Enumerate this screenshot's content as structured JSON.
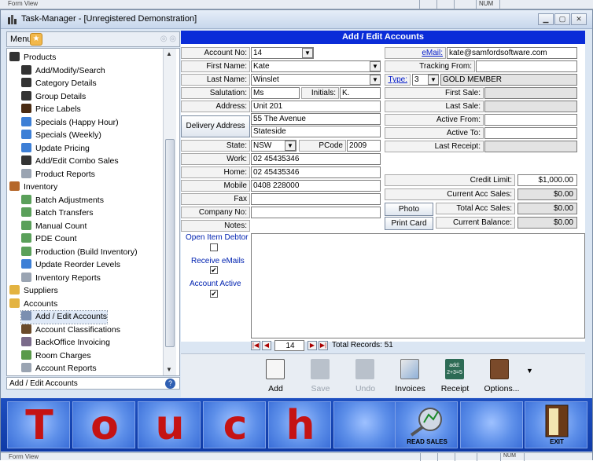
{
  "top_strip": {
    "label": "Form View",
    "indicator": "NUM"
  },
  "window": {
    "title": "Task-Manager - [Unregistered Demonstration]"
  },
  "menu": {
    "label": "Menu",
    "items": [
      {
        "label": "Products",
        "level": 0,
        "icon": "products-icon",
        "color": "#333333"
      },
      {
        "label": "Add/Modify/Search",
        "level": 1,
        "icon": "chart-icon",
        "color": "#333333"
      },
      {
        "label": "Category Details",
        "level": 1,
        "icon": "chart-icon",
        "color": "#333333"
      },
      {
        "label": "Group Details",
        "level": 1,
        "icon": "chart-icon",
        "color": "#333333"
      },
      {
        "label": "Price Labels",
        "level": 1,
        "icon": "label-icon",
        "color": "#4a2b12"
      },
      {
        "label": "Specials (Happy Hour)",
        "level": 1,
        "icon": "calendar-icon",
        "color": "#3d7fd6"
      },
      {
        "label": "Specials (Weekly)",
        "level": 1,
        "icon": "calendar-icon",
        "color": "#3d7fd6"
      },
      {
        "label": "Update Pricing",
        "level": 1,
        "icon": "calendar-icon",
        "color": "#3d7fd6"
      },
      {
        "label": "Add/Edit Combo Sales",
        "level": 1,
        "icon": "chart-icon",
        "color": "#333333"
      },
      {
        "label": "Product Reports",
        "level": 1,
        "icon": "report-icon",
        "color": "#9aa4b2"
      },
      {
        "label": "Inventory",
        "level": 0,
        "icon": "inventory-icon",
        "color": "#b5672a"
      },
      {
        "label": "Batch Adjustments",
        "level": 1,
        "icon": "checklist-icon",
        "color": "#5aa05a"
      },
      {
        "label": "Batch Transfers",
        "level": 1,
        "icon": "checklist-icon",
        "color": "#5aa05a"
      },
      {
        "label": "Manual Count",
        "level": 1,
        "icon": "checklist-icon",
        "color": "#5aa05a"
      },
      {
        "label": "PDE Count",
        "level": 1,
        "icon": "checklist-icon",
        "color": "#5aa05a"
      },
      {
        "label": "Production (Build Inventory)",
        "level": 1,
        "icon": "checklist-icon",
        "color": "#5aa05a"
      },
      {
        "label": "Update Reorder Levels",
        "level": 1,
        "icon": "calendar-icon",
        "color": "#3d7fd6"
      },
      {
        "label": "Inventory Reports",
        "level": 1,
        "icon": "report-icon",
        "color": "#9aa4b2"
      },
      {
        "label": "Suppliers",
        "level": 0,
        "icon": "folder-icon",
        "color": "#e3b341"
      },
      {
        "label": "Accounts",
        "level": 0,
        "icon": "folder-icon",
        "color": "#e3b341"
      },
      {
        "label": "Add / Edit Accounts",
        "level": 1,
        "icon": "accounts-icon",
        "color": "#7b8fb0"
      },
      {
        "label": "Account Classifications",
        "level": 1,
        "icon": "classification-icon",
        "color": "#6a4a2a"
      },
      {
        "label": "BackOffice Invoicing",
        "level": 1,
        "icon": "invoice-icon",
        "color": "#7a6a8a"
      },
      {
        "label": "Room Charges",
        "level": 1,
        "icon": "room-icon",
        "color": "#5a9a4a"
      },
      {
        "label": "Account Reports",
        "level": 1,
        "icon": "report-icon",
        "color": "#9aa4b2"
      }
    ],
    "status": "Add / Edit Accounts"
  },
  "form": {
    "header": "Add / Edit Accounts",
    "labels": {
      "account_no": "Account No:",
      "first_name": "First Name:",
      "last_name": "Last Name:",
      "salutation": "Salutation:",
      "initials": "Initials:",
      "address": "Address:",
      "delivery": "Delivery Address",
      "state": "State:",
      "pcode": "PCode",
      "work": "Work:",
      "home": "Home:",
      "mobile": "Mobile",
      "fax": "Fax",
      "company_no": "Company No:",
      "notes": "Notes:",
      "email": "eMail:",
      "tracking": "Tracking From:",
      "type": "Type:",
      "first_sale": "First Sale:",
      "last_sale": "Last Sale:",
      "active_from": "Active From:",
      "active_to": "Active To:",
      "last_receipt": "Last Receipt:",
      "credit_limit": "Credit Limit:",
      "current_acc_sales": "Current Acc Sales:",
      "total_acc_sales": "Total Acc Sales:",
      "current_balance": "Current Balance:",
      "open_item_debtor": "Open Item Debtor",
      "receive_emails": "Receive eMails",
      "account_active": "Account Active"
    },
    "values": {
      "account_no": "14",
      "first_name": "Kate",
      "last_name": "Winslet",
      "salutation": "Ms",
      "initials": "K.",
      "address": "Unit 201",
      "address2": "55 The Avenue",
      "address3": "Stateside",
      "state": "NSW",
      "pcode": "2009",
      "work": "02 45435346",
      "home": "02 45435346",
      "mobile": "0408 228000",
      "fax": "",
      "company_no": "",
      "notes": "",
      "email": "kate@samfordsoftware.com",
      "tracking": "",
      "type_no": "3",
      "type_name": "GOLD MEMBER",
      "credit_limit": "$1,000.00",
      "current_acc_sales": "$0.00",
      "total_acc_sales": "$0.00",
      "current_balance": "$0.00",
      "open_item_debtor": "",
      "receive_emails": "✔",
      "account_active": "✔"
    },
    "buttons": {
      "photo": "Photo",
      "print_card": "Print Card"
    }
  },
  "navigator": {
    "record": "14",
    "total_label": "Total Records: 51"
  },
  "toolbar": {
    "add": "Add",
    "save": "Save",
    "undo": "Undo",
    "invoices": "Invoices",
    "receipt": "Receipt",
    "options": "Options...",
    "receipt_icon_text": "add:\n2+3=5"
  },
  "band": {
    "letters": [
      "T",
      "o",
      "u",
      "c",
      "h"
    ],
    "read_sales": "READ SALES",
    "exit": "EXIT"
  },
  "status_bar": {
    "label": "Form View",
    "indicator": "NUM"
  },
  "colors": {
    "header_blue": "#0a2cd8",
    "band_blue": "#1d4fc0",
    "touch_red": "#c51313"
  }
}
